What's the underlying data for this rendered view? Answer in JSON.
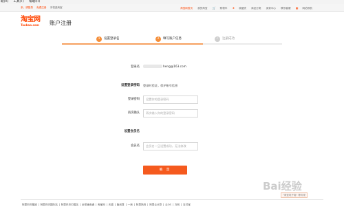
{
  "browser_menu": [
    "助(A)",
    "工具(T)",
    "帮助(H)"
  ],
  "topbar": {
    "left": [
      "亲，请登录",
      "免费注册",
      "手机逛淘宝"
    ],
    "right": [
      "淘宝网首页",
      "我的淘宝",
      "购物车",
      "收藏夹",
      "商品分类",
      "卖家中心",
      "联系客服",
      "网站导航"
    ]
  },
  "header": {
    "logo_main": "淘宝网",
    "logo_sub": "Taobao.com",
    "title": "账户注册"
  },
  "steps": [
    {
      "num": "1",
      "label": "设置登录名"
    },
    {
      "num": "2",
      "label": "填写账户信息"
    },
    {
      "num": "✓",
      "label": "注册成功"
    }
  ],
  "form": {
    "login_label": "登录名",
    "login_value": "heng@163.com",
    "password_section": "设置登录密码",
    "password_hint": "登录时验证，保护账号信息",
    "password_label": "登录密码",
    "password_placeholder": "设置你的登录密码",
    "confirm_label": "再次确认",
    "confirm_placeholder": "再次输入你的登录密码",
    "member_section": "设置会员名",
    "member_label": "会员名",
    "member_placeholder": "会员名一旦设置成功，无法修改",
    "submit_label": "确 定"
  },
  "footer_links": [
    "阿里巴巴集团",
    "阿里巴巴国际站",
    "阿里巴巴中国站",
    "全球速卖通",
    "淘宝网",
    "天猫",
    "聚划算",
    "一淘",
    "阿里妈妈",
    "阿里云计算",
    "云OS",
    "万网",
    "支付宝"
  ],
  "watermark": {
    "text": "Bai经验",
    "sub": "\"淘宝电子卷\" 等你来"
  },
  "colors": {
    "brand": "#ff4400",
    "button": "#f55a1e",
    "step_active": "#f58f3b"
  }
}
